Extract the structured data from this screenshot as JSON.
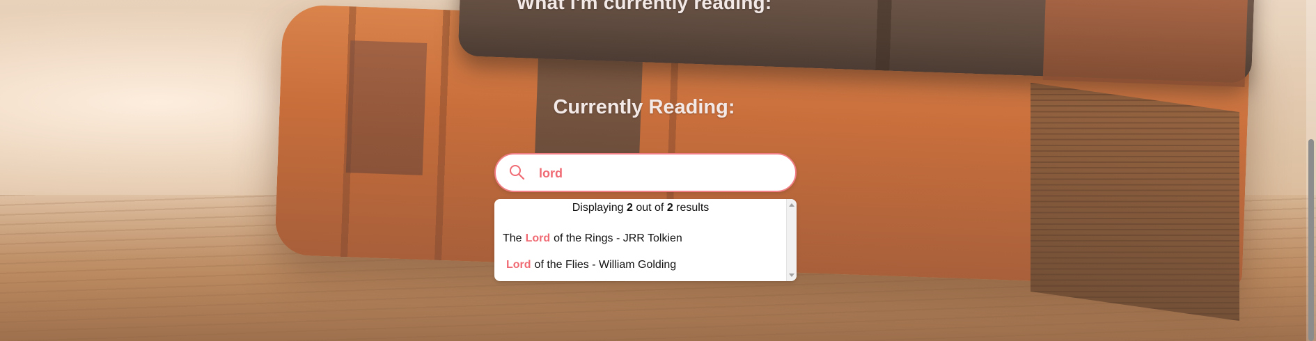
{
  "page": {
    "top_heading": "What I'm currently reading:",
    "section_heading": "Currently Reading:"
  },
  "search": {
    "icon": "search-icon",
    "value": "lord",
    "accent_color": "#f06a73"
  },
  "results": {
    "summary_prefix": "Displaying",
    "shown": "2",
    "summary_middle": "out of",
    "total": "2",
    "summary_suffix": "results",
    "items": [
      {
        "before": "The",
        "match": "Lord",
        "after": "of the Rings - JRR Tolkien"
      },
      {
        "before": "",
        "match": "Lord",
        "after": "of the Flies - William Golding"
      }
    ]
  },
  "colors": {
    "heading_text": "#f3e9e7",
    "highlight": "#f06a73"
  }
}
